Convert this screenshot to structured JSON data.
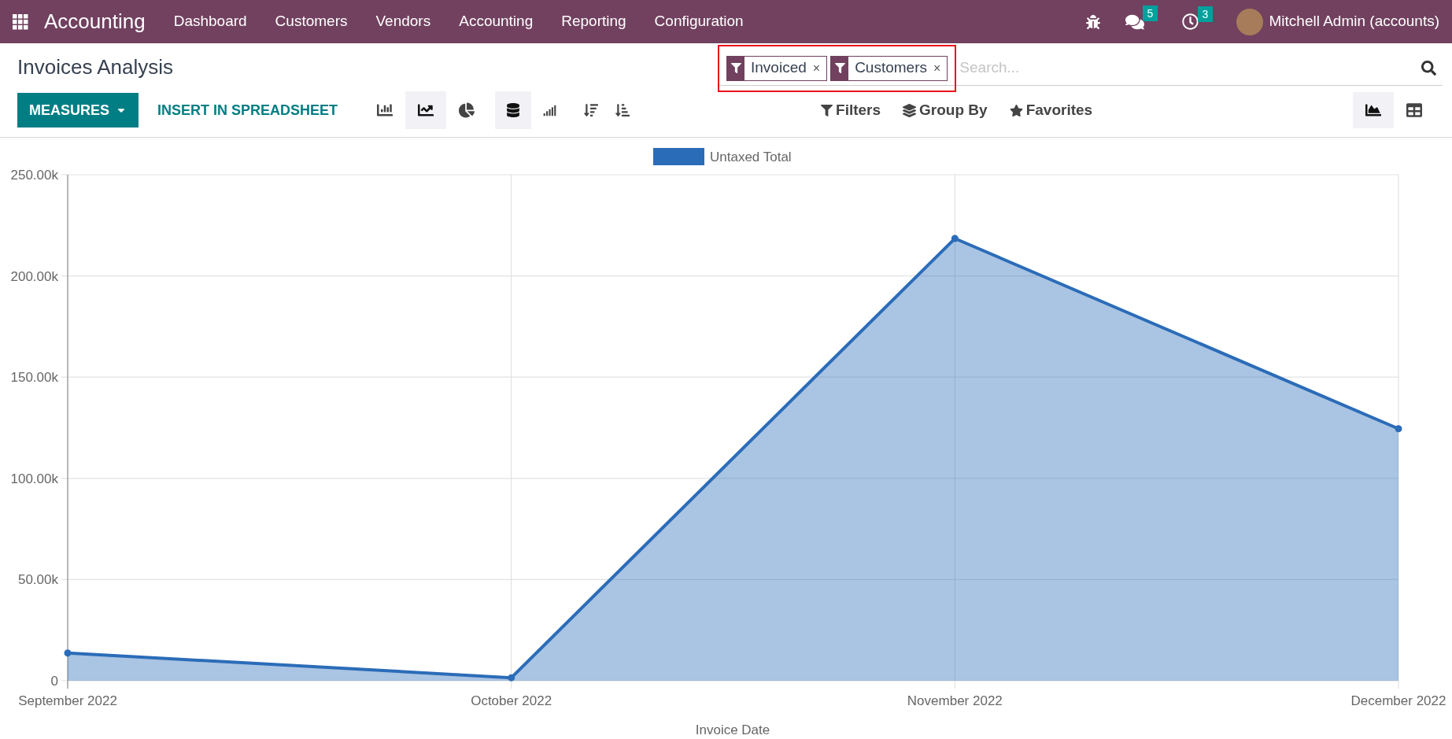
{
  "navbar": {
    "app": "Accounting",
    "menu": [
      "Dashboard",
      "Customers",
      "Vendors",
      "Accounting",
      "Reporting",
      "Configuration"
    ],
    "messages_count": "5",
    "activities_count": "3",
    "user": "Mitchell Admin (accounts)"
  },
  "title": "Invoices Analysis",
  "search": {
    "facets": [
      {
        "label": "Invoiced",
        "remove": "×"
      },
      {
        "label": "Customers",
        "remove": "×"
      }
    ],
    "placeholder": "Search...",
    "highlighted": true
  },
  "toolbar": {
    "measures": "MEASURES",
    "insert": "INSERT IN SPREADSHEET",
    "chart_modes": [
      {
        "kind": "bar",
        "selected": false
      },
      {
        "kind": "line",
        "selected": true
      },
      {
        "kind": "pie",
        "selected": false
      }
    ],
    "stacked": true,
    "cumulative": false,
    "filters": "Filters",
    "group_by": "Group By",
    "favorites": "Favorites",
    "views": [
      {
        "kind": "graph",
        "selected": true
      },
      {
        "kind": "pivot",
        "selected": false
      }
    ]
  },
  "chart": {
    "chart_data": {
      "type": "area",
      "grid": true,
      "xlabel": "Invoice Date",
      "categories": [
        "September 2022",
        "October 2022",
        "November 2022",
        "December 2022"
      ],
      "series": [
        {
          "name": "Untaxed Total",
          "color": "#2b6cb8",
          "values": [
            13700,
            1500,
            218500,
            124500
          ]
        }
      ],
      "ylim": [
        0,
        250000
      ],
      "yticks": [
        {
          "value": 0,
          "label": "0"
        },
        {
          "value": 50000,
          "label": "50.00k"
        },
        {
          "value": 100000,
          "label": "100.00k"
        },
        {
          "value": 150000,
          "label": "150.00k"
        },
        {
          "value": 200000,
          "label": "200.00k"
        },
        {
          "value": 250000,
          "label": "250.00k"
        }
      ]
    }
  }
}
